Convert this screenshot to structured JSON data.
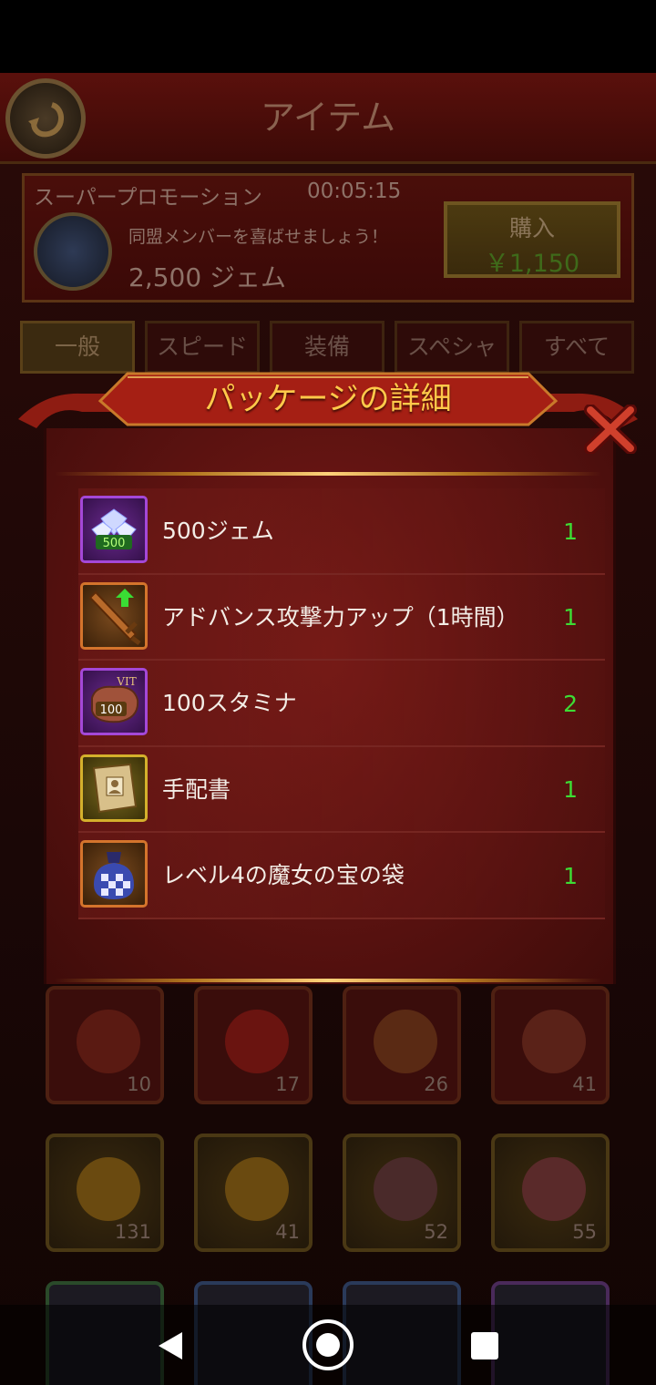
{
  "header": {
    "title": "アイテム"
  },
  "promo": {
    "title": "スーパープロモーション",
    "timer": "00:05:15",
    "description": "同盟メンバーを喜ばせましょう！",
    "gems": "2,500 ジェム",
    "buy_label": "購入",
    "buy_price": "￥1,150"
  },
  "tabs": [
    {
      "label": "一般"
    },
    {
      "label": "スピード"
    },
    {
      "label": "装備"
    },
    {
      "label": "スペシャル"
    },
    {
      "label": "すべて"
    }
  ],
  "background_items": {
    "row1_counts": [
      "10",
      "17",
      "26",
      "41"
    ],
    "row2_counts": [
      "131",
      "41",
      "52",
      "55"
    ]
  },
  "modal": {
    "title": "パッケージの詳細",
    "items": [
      {
        "name": "500ジェム",
        "qty": "1",
        "icon": "gems-icon",
        "badge": "500"
      },
      {
        "name": "アドバンス攻撃力アップ（1時間）",
        "qty": "1",
        "icon": "sword-boost-icon"
      },
      {
        "name": "100スタミナ",
        "qty": "2",
        "icon": "stamina-meat-icon",
        "badge": "100",
        "badge_top": "VIT"
      },
      {
        "name": "手配書",
        "qty": "1",
        "icon": "wanted-poster-icon"
      },
      {
        "name": "レベル4の魔女の宝の袋",
        "qty": "1",
        "icon": "witch-treasure-bag-icon"
      }
    ]
  },
  "colors": {
    "accent_gold": "#ffc94a",
    "qty_green": "#3ddc34",
    "panel_red": "#5a1210"
  }
}
